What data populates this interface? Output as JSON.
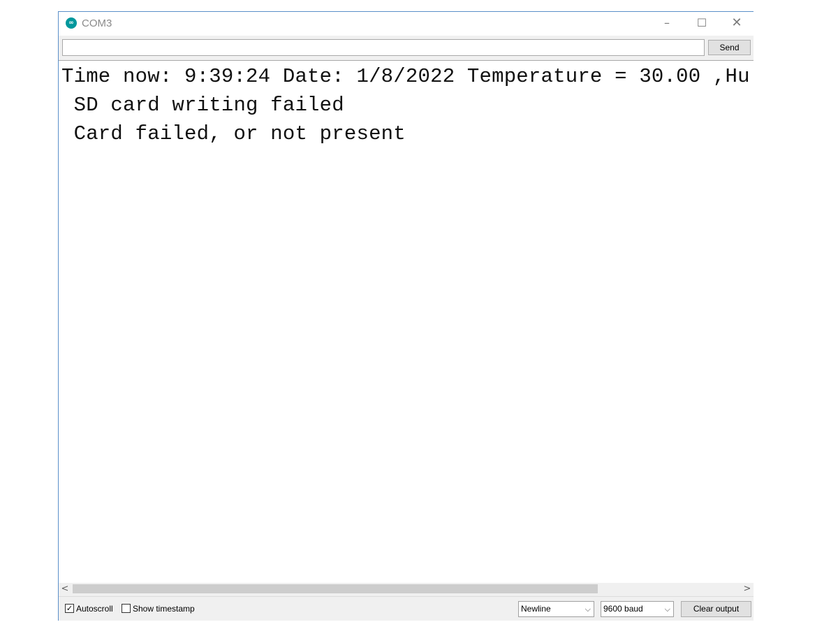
{
  "window": {
    "title": "COM3",
    "icon": "arduino-logo-icon",
    "controls": {
      "minimize": "–",
      "maximize": "☐",
      "close": "✕"
    }
  },
  "send_bar": {
    "input_value": "",
    "send_label": "Send"
  },
  "output": {
    "lines": [
      "Time now: 9:39:24 Date: 1/8/2022 Temperature = 30.00 ,Hu",
      " SD card writing failed",
      " Card failed, or not present"
    ]
  },
  "scrollbar": {
    "left_arrow": "<",
    "right_arrow": ">"
  },
  "status_bar": {
    "autoscroll_label": "Autoscroll",
    "autoscroll_checked": true,
    "timestamp_label": "Show timestamp",
    "timestamp_checked": false,
    "line_ending": "Newline",
    "baud_rate": "9600 baud",
    "clear_label": "Clear output"
  },
  "colors": {
    "accent": "#00979c",
    "window_border": "#5b8fc9"
  }
}
